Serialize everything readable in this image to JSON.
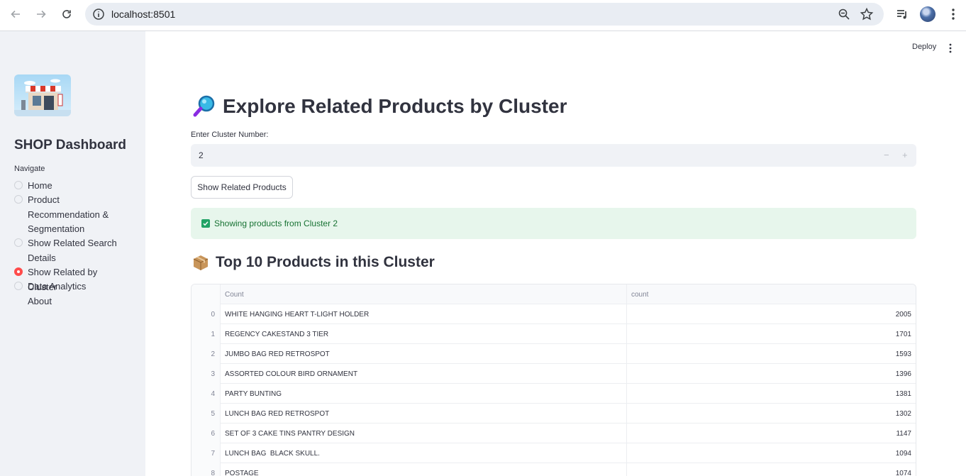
{
  "browser": {
    "url": "localhost:8501"
  },
  "sidebar": {
    "title": "SHOP Dashboard",
    "nav_label": "Navigate",
    "items": [
      {
        "label": "Home",
        "selected": false
      },
      {
        "label": "Product Recommendation & Segmentation",
        "selected": false
      },
      {
        "label": "Show Related Search Details",
        "selected": false
      },
      {
        "label": "Show Related by Cluster",
        "selected": true
      },
      {
        "label": "Data Analytics",
        "selected": false
      },
      {
        "label": "About",
        "selected": false
      }
    ]
  },
  "header": {
    "deploy_label": "Deploy"
  },
  "main": {
    "title": "Explore Related Products by Cluster",
    "input_label": "Enter Cluster Number:",
    "input_value": "2",
    "button_label": "Show Related Products",
    "alert_text": "Showing products from Cluster 2",
    "section_title": "Top 10 Products in this Cluster",
    "table": {
      "columns": [
        "Count",
        "count"
      ],
      "rows": [
        {
          "index": "0",
          "name": "WHITE HANGING HEART T-LIGHT HOLDER",
          "count": "2005"
        },
        {
          "index": "1",
          "name": "REGENCY CAKESTAND 3 TIER",
          "count": "1701"
        },
        {
          "index": "2",
          "name": "JUMBO BAG RED RETROSPOT",
          "count": "1593"
        },
        {
          "index": "3",
          "name": "ASSORTED COLOUR BIRD ORNAMENT",
          "count": "1396"
        },
        {
          "index": "4",
          "name": "PARTY BUNTING",
          "count": "1381"
        },
        {
          "index": "5",
          "name": "LUNCH BAG RED RETROSPOT",
          "count": "1302"
        },
        {
          "index": "6",
          "name": "SET OF 3 CAKE TINS PANTRY DESIGN",
          "count": "1147"
        },
        {
          "index": "7",
          "name": "LUNCH BAG  BLACK SKULL.",
          "count": "1094"
        },
        {
          "index": "8",
          "name": "POSTAGE",
          "count": "1074"
        }
      ]
    }
  },
  "colors": {
    "accent": "#ff4b4b",
    "sidebar_bg": "#f0f2f6",
    "success_bg": "#e7f6ec",
    "success_text": "#177233"
  }
}
